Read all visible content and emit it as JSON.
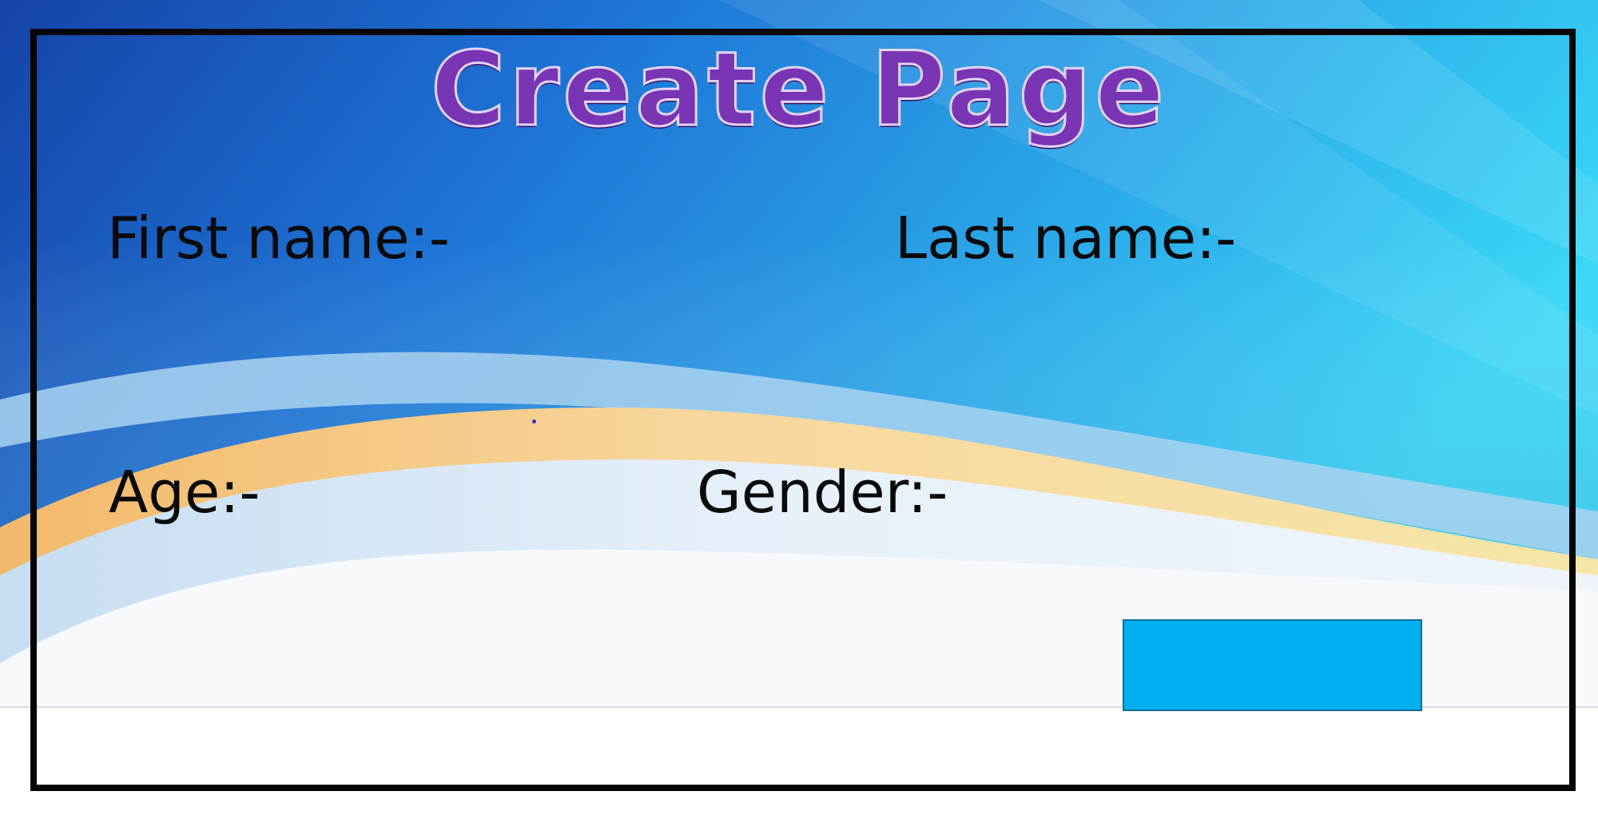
{
  "page": {
    "title": "Create Page"
  },
  "form": {
    "first_name_label": "First name:-",
    "last_name_label": "Last name:-",
    "age_label": "Age:-",
    "gender_label": "Gender:-"
  },
  "colors": {
    "title": "#7a35b4",
    "button": "#00b0f0",
    "frame": "#050505"
  }
}
